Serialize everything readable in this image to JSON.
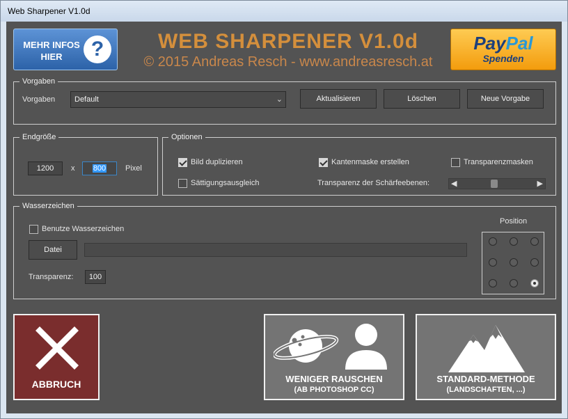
{
  "window": {
    "title": "Web Sharpener V1.0d"
  },
  "header": {
    "info_button": {
      "line1": "MEHR INFOS",
      "line2": "HIER",
      "icon": "question-mark"
    },
    "title": "WEB SHARPENER V1.0d",
    "subtitle": "© 2015 Andreas Resch - www.andreasresch.at",
    "paypal": {
      "word1": "Pay",
      "word2": "Pal",
      "label": "Spenden"
    }
  },
  "vorgaben": {
    "legend": "Vorgaben",
    "label": "Vorgaben",
    "selected": "Default",
    "buttons": {
      "update": "Aktualisieren",
      "delete": "Löschen",
      "new": "Neue Vorgabe"
    }
  },
  "endgroesse": {
    "legend": "Endgröße",
    "width": "1200",
    "separator": "x",
    "height": "800",
    "unit": "Pixel"
  },
  "optionen": {
    "legend": "Optionen",
    "duplicate": {
      "label": "Bild duplizieren",
      "checked": true
    },
    "edge_mask": {
      "label": "Kantenmaske erstellen",
      "checked": true
    },
    "transparency_masks": {
      "label": "Transparenzmasken",
      "checked": false
    },
    "saturation": {
      "label": "Sättigungsausgleich",
      "checked": false
    },
    "layer_transparency": {
      "label": "Transparenz der Schärfeebenen:",
      "value_percent": 50
    }
  },
  "wasserzeichen": {
    "legend": "Wasserzeichen",
    "use": {
      "label": "Benutze Wasserzeichen",
      "checked": false
    },
    "file_button": "Datei",
    "file_path": "",
    "transparency_label": "Transparenz:",
    "transparency_value": "100",
    "position_label": "Position",
    "position_selected": "bottom-right"
  },
  "actions": {
    "cancel": {
      "label": "ABBRUCH",
      "icon": "x-icon",
      "color": "#7a2d2d"
    },
    "less_noise": {
      "line1": "WENIGER RAUSCHEN",
      "line2": "(AB PHOTOSHOP CC)",
      "icon": "planet-person-icon"
    },
    "standard": {
      "line1": "STANDARD-METHODE",
      "line2": "(LANDSCHAFTEN, ...)",
      "icon": "mountains-icon"
    }
  },
  "colors": {
    "background": "#535353",
    "title_orange": "#d48f3c",
    "info_blue": "#2c62a8",
    "paypal_orange": "#f39c0d",
    "button_gray": "#747474"
  }
}
